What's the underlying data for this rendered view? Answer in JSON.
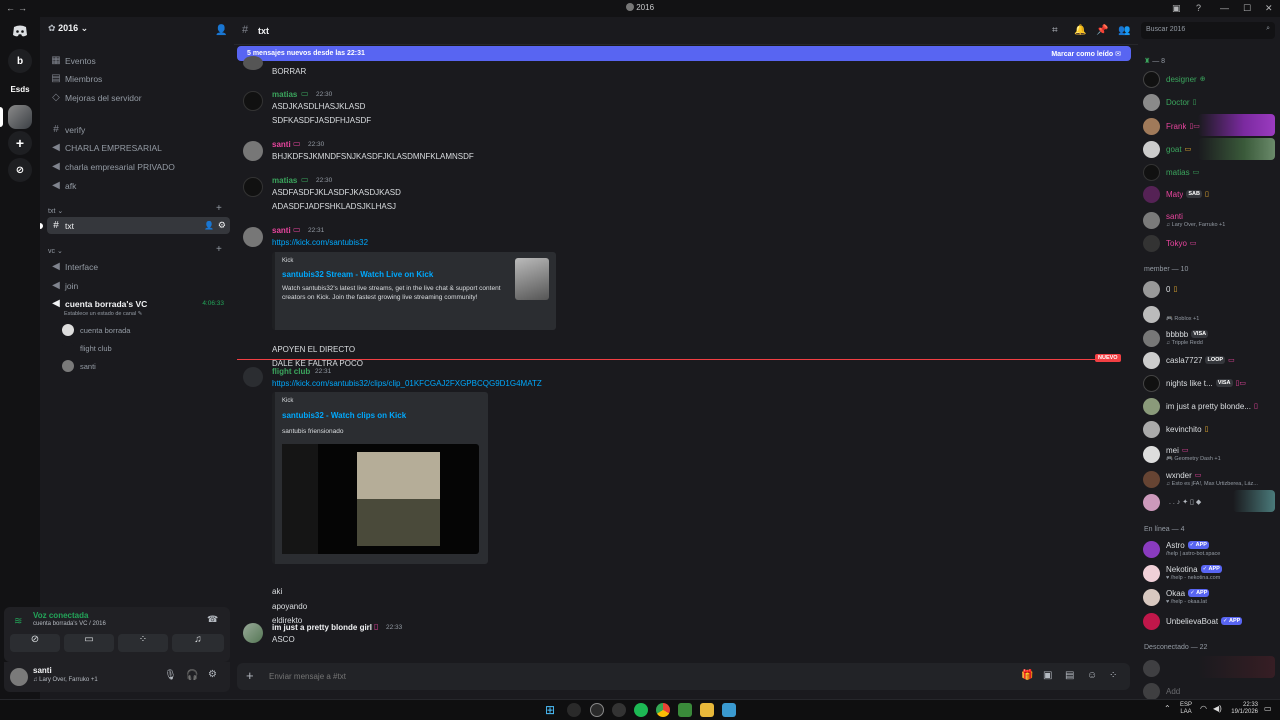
{
  "titlebar": {
    "title": "2016"
  },
  "guilds": {
    "items": [
      {
        "label": "b"
      },
      {
        "label": "Esds"
      }
    ]
  },
  "server": {
    "name": "2016"
  },
  "channels": {
    "top": [
      {
        "label": "Eventos"
      },
      {
        "label": "Miembros"
      },
      {
        "label": "Mejoras del servidor"
      }
    ],
    "list": [
      {
        "label": "verify"
      },
      {
        "label": "CHARLA EMPRESARIAL"
      },
      {
        "label": "charla empresarial PRIVADO"
      },
      {
        "label": "afk"
      }
    ],
    "cat_txt": "txt",
    "active": "txt",
    "cat_vc": "vc",
    "vc": [
      {
        "label": "Interface"
      },
      {
        "label": "join"
      }
    ],
    "vc_active": {
      "label": "cuenta borrada's VC",
      "time": "4:06:33",
      "status": "Establece un estado de canal"
    },
    "vc_users": [
      {
        "name": "cuenta borrada"
      },
      {
        "name": "flight club"
      },
      {
        "name": "santi"
      }
    ]
  },
  "voice": {
    "title": "Voz conectada",
    "sub": "cuenta borrada's VC / 2016"
  },
  "user": {
    "name": "santi",
    "status": "Lary Over, Farruko +1"
  },
  "header": {
    "channel": "txt"
  },
  "newbar": {
    "text": "5 mensajes nuevos desde las 22:31",
    "action": "Marcar como leído"
  },
  "messages": {
    "m0": {
      "lines": [
        "BORRAR"
      ]
    },
    "m1": {
      "user": "matias",
      "time": "22:30",
      "lines": [
        "ASDJKASDLHASJKLASD",
        "SDFKASDFJASDFHJASDF"
      ]
    },
    "m2": {
      "user": "santi",
      "time": "22:30",
      "lines": [
        "BHJKDFSJKMNDFSNJKASDFJKLASDMNFKLAMNSDF"
      ]
    },
    "m3": {
      "user": "matias",
      "time": "22:30",
      "lines": [
        "ASDFASDFJKLASDFJKASDJKASD",
        "ADASDFJADFSHKLADSJKLHASJ"
      ]
    },
    "m4": {
      "user": "santi",
      "time": "22:31",
      "link": "https://kick.com/santubis32",
      "embed": {
        "provider": "Kick",
        "title": "santubis32 Stream - Watch Live on Kick",
        "desc": "Watch santubis32's latest live streams, get in the live chat & support content creators on Kick. Join the fastest growing live streaming community!"
      },
      "lines": [
        "APOYEN EL DIRECTO",
        "DALE KE FALTRA POCO"
      ]
    },
    "divider": "NUEVO",
    "m5": {
      "user": "flight club",
      "time": "22:31",
      "link": "https://kick.com/santubis32/clips/clip_01KFCGAJ2FXGPBCQG9D1G4MATZ",
      "embed": {
        "provider": "Kick",
        "title": "santubis32 - Watch clips on Kick",
        "desc": "santubis friensionado"
      },
      "lines": [
        "aki",
        "apoyando",
        "eldirekto"
      ]
    },
    "m6": {
      "user": "im just a pretty blonde girl",
      "time": "22:33",
      "lines": [
        "ASCO"
      ]
    }
  },
  "input": {
    "placeholder": "Enviar mensaje a #txt"
  },
  "members": {
    "search": "Buscar 2016",
    "role1": "— 8",
    "group1": [
      {
        "name": "designer",
        "color": "#3ba55d"
      },
      {
        "name": "Doctor",
        "color": "#3ba55d"
      },
      {
        "name": "Frank",
        "color": "#e8459e"
      },
      {
        "name": "goat",
        "color": "#3ba55d"
      },
      {
        "name": "matias",
        "color": "#3ba55d"
      },
      {
        "name": "Maty",
        "color": "#e8459e",
        "tag": "SAB"
      },
      {
        "name": "santi",
        "color": "#e8459e",
        "sub": "Lary Over, Farruko +1"
      },
      {
        "name": "Tokyo",
        "color": "#e8459e"
      }
    ],
    "role2": "member — 10",
    "group2": [
      {
        "name": "0"
      },
      {
        "name": "",
        "sub": "Roblox +1"
      },
      {
        "name": "bbbbb",
        "tag": "VISA",
        "sub": "Tripple Redd"
      },
      {
        "name": "casla7727",
        "tag": "LOOP"
      },
      {
        "name": "nights like t...",
        "tag": "VISA"
      },
      {
        "name": "im just a pretty blonde..."
      },
      {
        "name": "kevinchito"
      },
      {
        "name": "mei",
        "sub": "Geometry Dash +1"
      },
      {
        "name": "wxnder",
        "sub": "Esto es jFA!, Max Urtizberea, Láz..."
      },
      {
        "name": ""
      }
    ],
    "role3": "En línea — 4",
    "group3": [
      {
        "name": "Astro",
        "badge": "APP",
        "sub": "/help | astro-bot.space"
      },
      {
        "name": "Nekotina",
        "badge": "APP",
        "sub": "/help - nekotina.com"
      },
      {
        "name": "Okaa",
        "badge": "APP",
        "sub": "/help - okaa.lat"
      },
      {
        "name": "UnbelievaBoat",
        "badge": "APP"
      }
    ],
    "role4": "Desconectado — 22",
    "group4": [
      {
        "name": ""
      },
      {
        "name": "Add"
      }
    ]
  },
  "taskbar": {
    "lang1": "ESP",
    "lang2": "LAA",
    "time": "22:33",
    "date": "19/1/2026"
  }
}
